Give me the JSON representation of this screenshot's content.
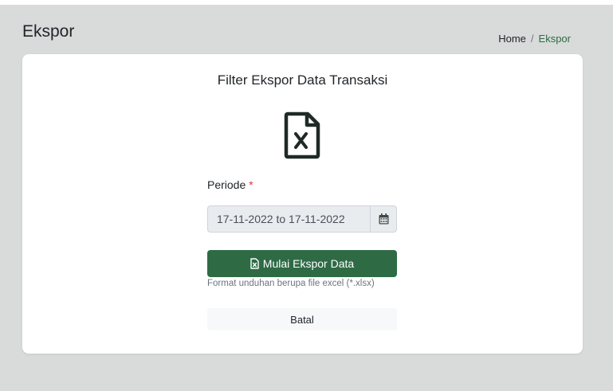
{
  "header": {
    "page_title": "Ekspor",
    "breadcrumb": {
      "home": "Home",
      "separator": "/",
      "current": "Ekspor"
    }
  },
  "card": {
    "title": "Filter Ekspor Data Transaksi",
    "file_icon": "file-excel-icon",
    "periode_label": "Periode",
    "required_mark": "*",
    "date_range_value": "17-11-2022 to 17-11-2022",
    "calendar_icon": "calendar-icon",
    "export_button_label": "Mulai Ekspor Data",
    "export_button_icon": "file-excel-icon",
    "help_text": "Format unduhan berupa file excel (*.xlsx)",
    "cancel_button_label": "Batal"
  },
  "colors": {
    "primary": "#2e6b45",
    "background": "#d8dbda",
    "required": "#dc3545"
  }
}
